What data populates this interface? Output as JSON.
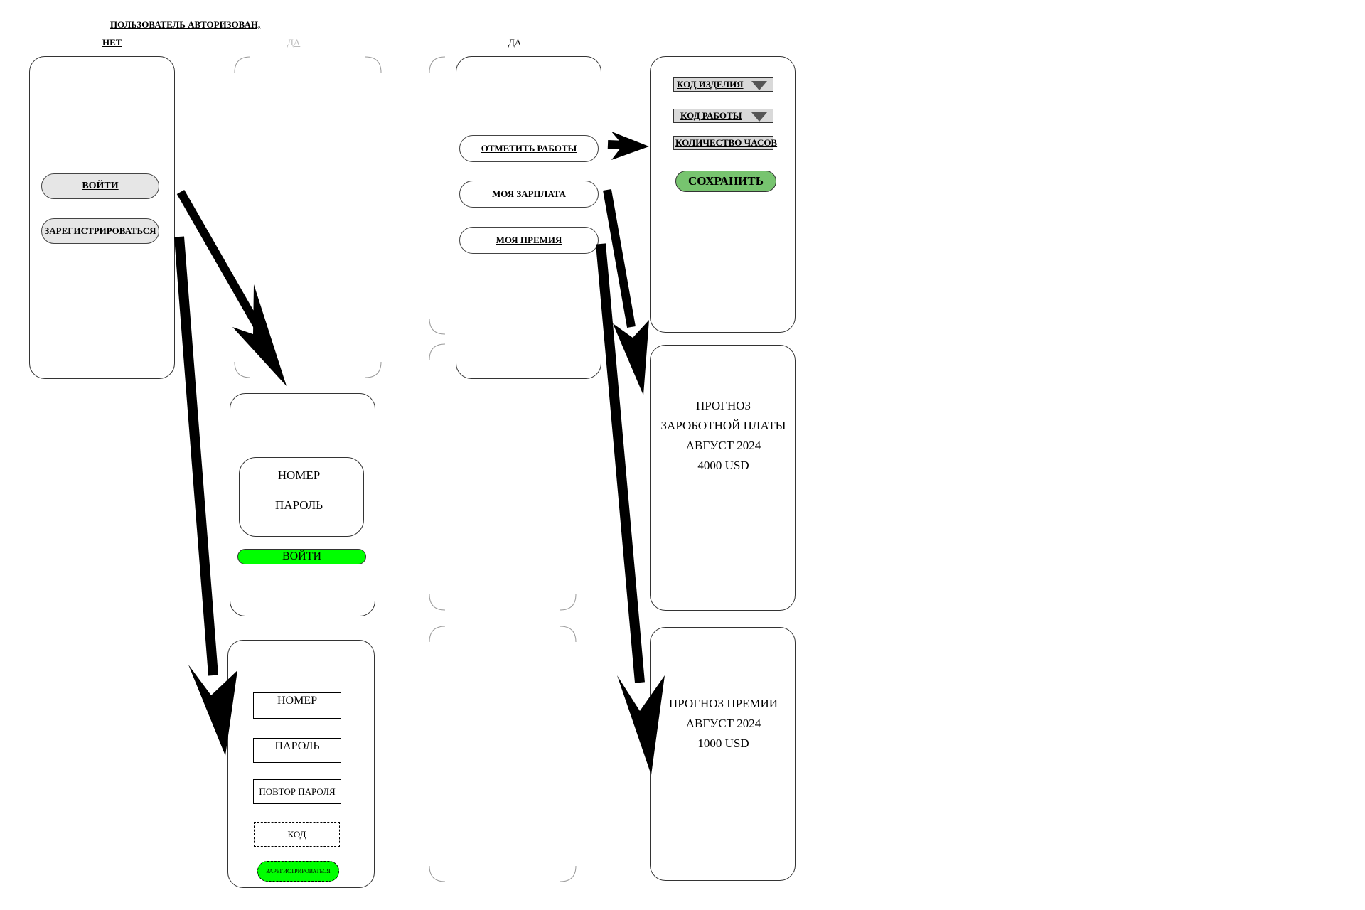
{
  "headers": {
    "authorized": "ПОЛЬЗОВАТЕЛЬ АВТОРИЗОВАН,",
    "no": "НЕТ",
    "yes_faded": "ДА",
    "yes": "ДА"
  },
  "start_screen": {
    "login_button": "ВОЙТИ",
    "register_button": "ЗАРЕГИСТРИРОВАТЬСЯ"
  },
  "login_screen": {
    "number_label": "НОМЕР",
    "password_label": "ПАРОЛЬ",
    "login_button": "ВОЙТИ",
    "accent": "#00ff00"
  },
  "register_screen": {
    "number_field": "НОМЕР",
    "password_field": "ПАРОЛЬ",
    "repeat_password_field": "ПОВТОР ПАРОЛЯ",
    "code_field": "КОД",
    "register_button": "ЗАРЕГИСТРИРОВАТЬСЯ",
    "accent": "#00ff00"
  },
  "menu_screen": {
    "mark_work_button": "ОТМЕТИТЬ РАБОТЫ",
    "my_salary_button": "МОЯ ЗАРПЛАТА",
    "my_bonus_button": "МОЯ ПРЕМИЯ"
  },
  "mark_work_screen": {
    "product_code_select": "КОД ИЗДЕЛИЯ",
    "work_code_select": "КОД РАБОТЫ",
    "hours_field": "КОЛИЧЕСТВО ЧАСОВ",
    "save_button": "СОХРАНИТЬ",
    "save_color": "#77c46f"
  },
  "salary_screen": {
    "line1": "ПРОГНОЗ",
    "line2": "ЗАРОБОТНОЙ ПЛАТЫ",
    "line3": "АВГУСТ 2024",
    "line4": "4000 USD"
  },
  "bonus_screen": {
    "line1": "ПРОГНОЗ ПРЕМИИ",
    "line2": "АВГУСТ 2024",
    "line3": "1000  USD"
  }
}
